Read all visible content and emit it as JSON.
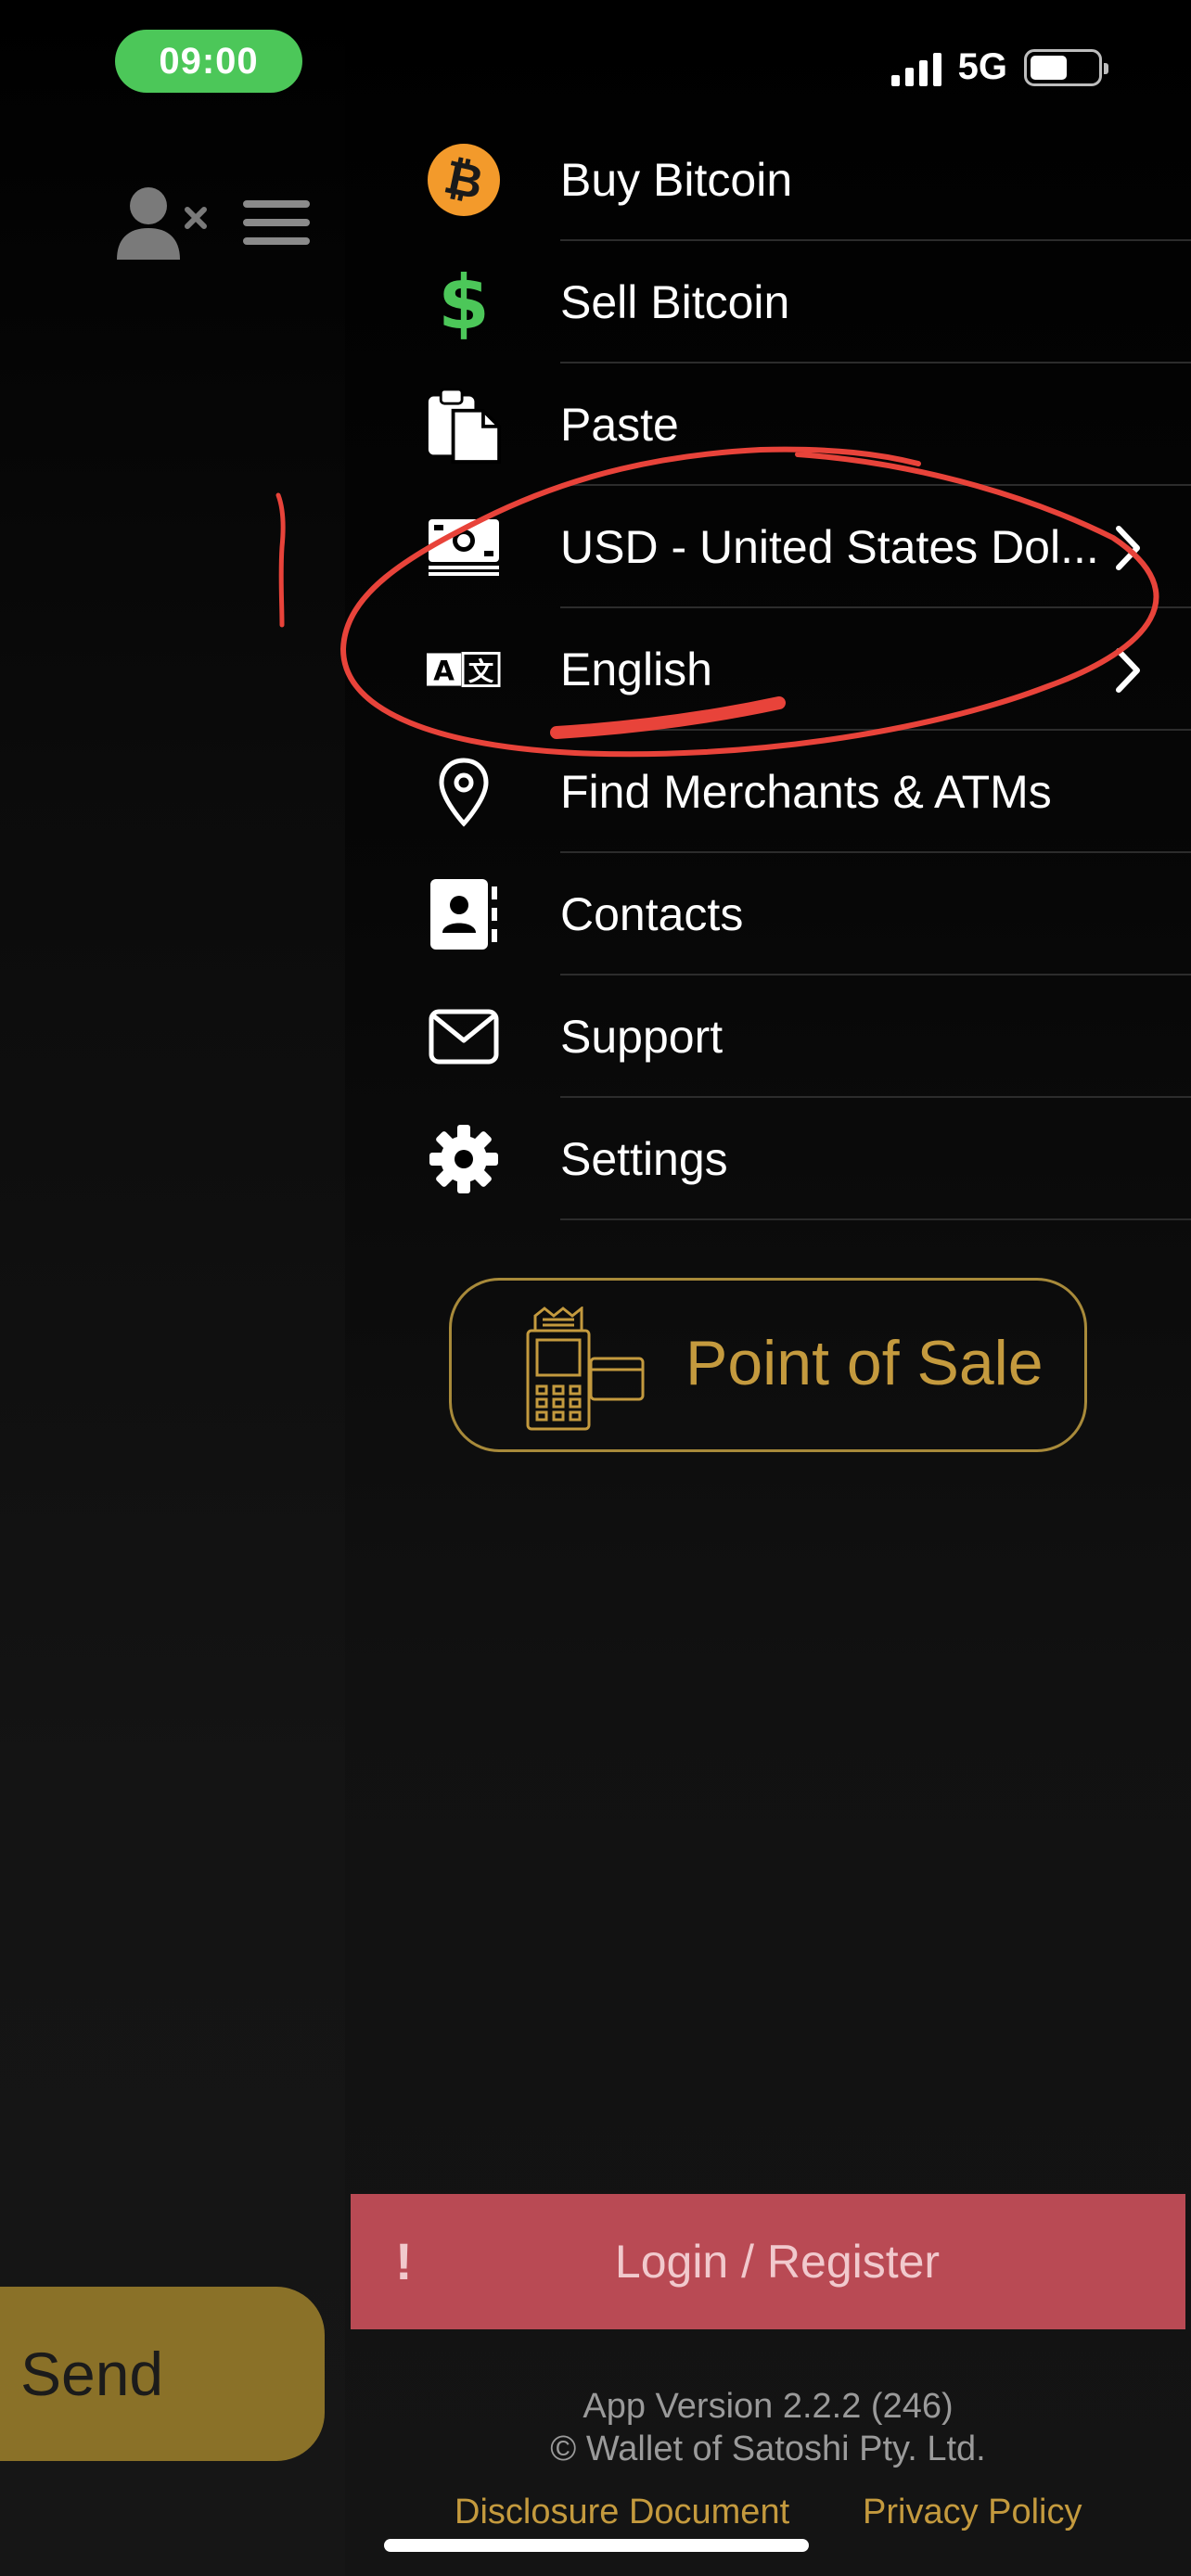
{
  "status_bar": {
    "time": "09:00",
    "network": "5G",
    "battery_fraction": 0.55
  },
  "menu": {
    "items": [
      {
        "label": "Buy Bitcoin",
        "icon": "bitcoin-icon",
        "chevron": false
      },
      {
        "label": "Sell Bitcoin",
        "icon": "dollar-icon",
        "chevron": false
      },
      {
        "label": "Paste",
        "icon": "clipboard-icon",
        "chevron": false
      },
      {
        "label": "USD - United States Dol...",
        "icon": "banknote-icon",
        "chevron": true
      },
      {
        "label": "English",
        "icon": "translate-icon",
        "chevron": true
      },
      {
        "label": "Find Merchants & ATMs",
        "icon": "map-pin-icon",
        "chevron": false
      },
      {
        "label": "Contacts",
        "icon": "contacts-icon",
        "chevron": false
      },
      {
        "label": "Support",
        "icon": "envelope-icon",
        "chevron": false
      },
      {
        "label": "Settings",
        "icon": "gear-icon",
        "chevron": false
      }
    ]
  },
  "point_of_sale": {
    "label": "Point of Sale"
  },
  "login": {
    "icon": "!",
    "label": "Login / Register"
  },
  "send": {
    "label": "Send"
  },
  "footer": {
    "version": "App Version 2.2.2 (246)",
    "copyright": "© Wallet of Satoshi Pty. Ltd.",
    "disclosure": "Disclosure Document",
    "privacy": "Privacy Policy"
  },
  "colors": {
    "accent_gold": "#c49a3e",
    "bitcoin_orange": "#f39a2b",
    "dollar_green": "#4cc759",
    "login_red": "#b94a54",
    "annotation_red": "#e8433a"
  }
}
